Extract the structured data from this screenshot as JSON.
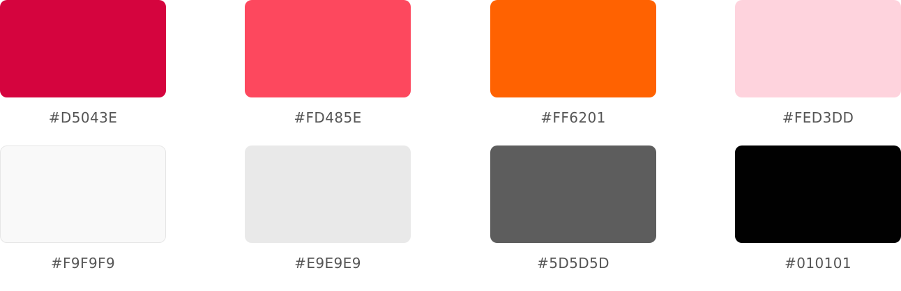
{
  "swatches": [
    {
      "hex": "#D5043E",
      "label": "#D5043E"
    },
    {
      "hex": "#FD485E",
      "label": "#FD485E"
    },
    {
      "hex": "#FF6201",
      "label": "#FF6201"
    },
    {
      "hex": "#FED3DD",
      "label": "#FED3DD"
    },
    {
      "hex": "#F9F9F9",
      "label": "#F9F9F9"
    },
    {
      "hex": "#E9E9E9",
      "label": "#E9E9E9"
    },
    {
      "hex": "#5D5D5D",
      "label": "#5D5D5D"
    },
    {
      "hex": "#010101",
      "label": "#010101"
    }
  ]
}
